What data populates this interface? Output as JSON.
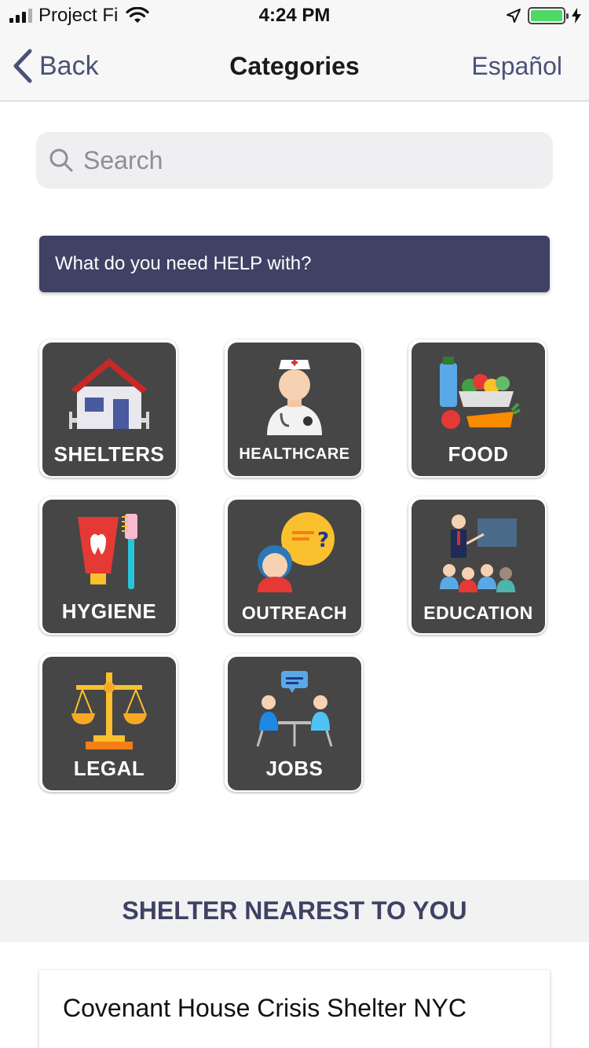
{
  "status_bar": {
    "carrier": "Project Fi",
    "time": "4:24 PM"
  },
  "nav": {
    "back_label": "Back",
    "title": "Categories",
    "language_label": "Español"
  },
  "search": {
    "placeholder": "Search",
    "value": ""
  },
  "help_banner": {
    "text": "What do you need HELP with?"
  },
  "categories": [
    {
      "label": "SHELTERS",
      "icon": "house-icon"
    },
    {
      "label": "HEALTHCARE",
      "icon": "nurse-icon"
    },
    {
      "label": "FOOD",
      "icon": "food-basket-icon"
    },
    {
      "label": "HYGIENE",
      "icon": "toothpaste-toothbrush-icon"
    },
    {
      "label": "OUTREACH",
      "icon": "person-question-bubble-icon"
    },
    {
      "label": "EDUCATION",
      "icon": "classroom-icon"
    },
    {
      "label": "LEGAL",
      "icon": "scales-of-justice-icon"
    },
    {
      "label": "JOBS",
      "icon": "interview-icon"
    }
  ],
  "nearest": {
    "header": "SHELTER NEAREST TO YOU",
    "shelter_name": "Covenant House Crisis Shelter NYC"
  },
  "colors": {
    "accent": "#4a5278",
    "banner": "#3f4264",
    "tile": "#464646",
    "battery": "#4cd964"
  }
}
